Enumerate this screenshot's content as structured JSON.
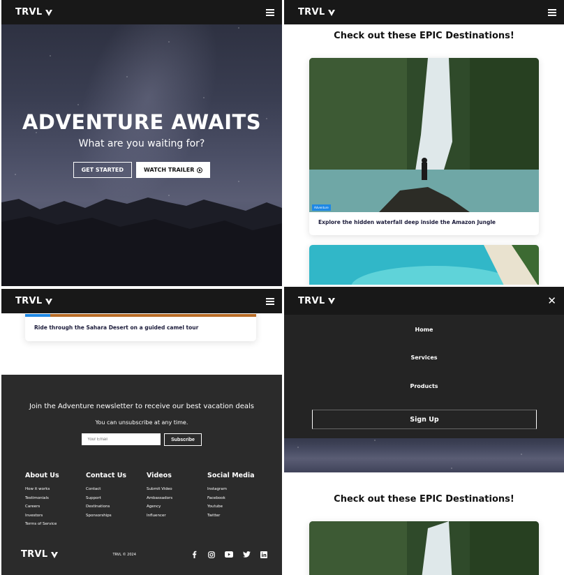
{
  "brand": {
    "name": "TRVL"
  },
  "hero": {
    "title": "ADVENTURE AWAITS",
    "subtitle": "What are you waiting for?",
    "primary_button": "GET STARTED",
    "secondary_button": "WATCH TRAILER"
  },
  "destinations": {
    "title": "Check out these EPIC Destinations!",
    "cards": [
      {
        "badge": "Adventure",
        "text": "Explore the hidden waterfall deep inside the Amazon Jungle"
      },
      {
        "text": "Ride through the Sahara Desert on a guided camel tour"
      }
    ]
  },
  "newsletter": {
    "title": "Join the Adventure newsletter to receive our best vacation deals",
    "subtitle": "You can unsubscribe at any time.",
    "email_placeholder": "Your Email",
    "button": "Subscribe"
  },
  "footer": {
    "columns": [
      {
        "title": "About Us",
        "links": [
          "How it works",
          "Testimonials",
          "Careers",
          "Investors",
          "Terms of Service"
        ]
      },
      {
        "title": "Contact Us",
        "links": [
          "Contact",
          "Support",
          "Destinations",
          "Sponsorships"
        ]
      },
      {
        "title": "Videos",
        "links": [
          "Submit Video",
          "Ambassadors",
          "Agency",
          "Influencer"
        ]
      },
      {
        "title": "Social Media",
        "links": [
          "Instagram",
          "Facebook",
          "Youtube",
          "Twitter"
        ]
      }
    ],
    "copyright": "TRVL © 2024",
    "social_icons": [
      "facebook-icon",
      "instagram-icon",
      "youtube-icon",
      "twitter-icon",
      "linkedin-icon"
    ]
  },
  "mobile_menu": {
    "items": [
      "Home",
      "Services",
      "Products"
    ],
    "signup": "Sign Up"
  },
  "colors": {
    "navbar": "#181818",
    "footer": "#2b2b2b",
    "menu": "#242424",
    "badge": "#1e88e5"
  }
}
